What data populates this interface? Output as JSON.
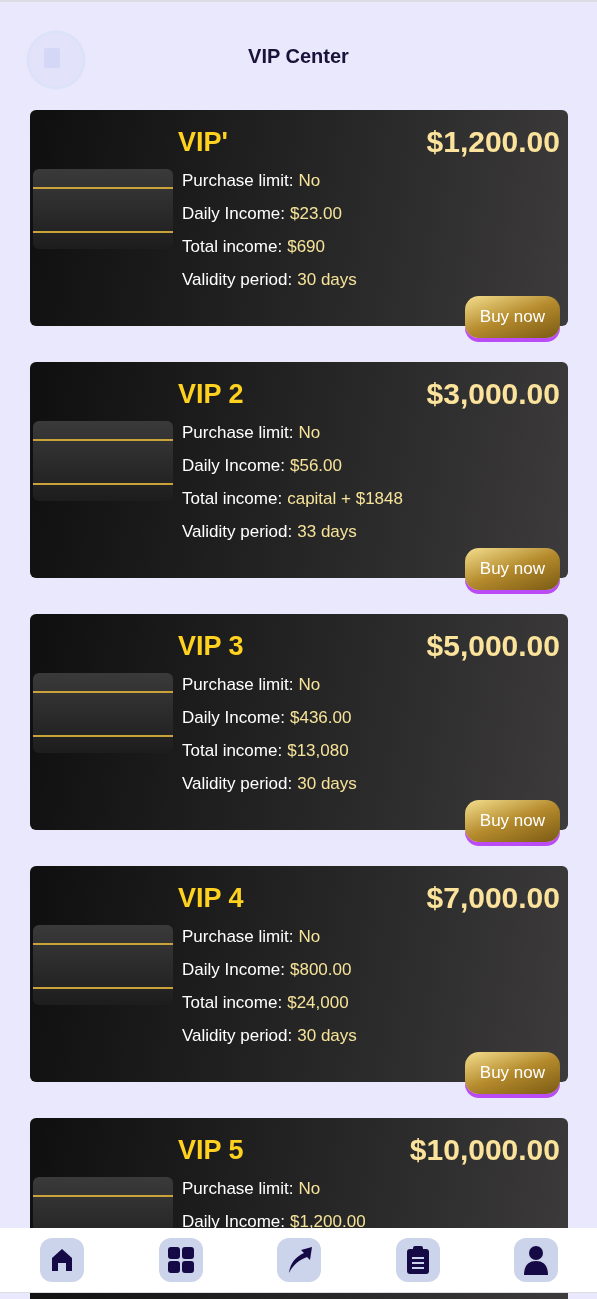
{
  "header": {
    "title": "VIP Center"
  },
  "plans": [
    {
      "name": "VIP'",
      "price": "$1,200.00",
      "rows": [
        {
          "label": "Purchase limit:",
          "value": "No"
        },
        {
          "label": "Daily Income:",
          "value": "$23.00"
        },
        {
          "label": "Total income:",
          "value": "$690"
        },
        {
          "label": "Validity period:",
          "value": "30 days"
        }
      ],
      "button": "Buy now"
    },
    {
      "name": "VIP 2",
      "price": "$3,000.00",
      "rows": [
        {
          "label": "Purchase limit:",
          "value": "No"
        },
        {
          "label": "Daily Income:",
          "value": "$56.00"
        },
        {
          "label": "Total income:",
          "value": "capital + $1848"
        },
        {
          "label": "Validity period:",
          "value": "33 days"
        }
      ],
      "button": "Buy now"
    },
    {
      "name": "VIP 3",
      "price": "$5,000.00",
      "rows": [
        {
          "label": "Purchase limit:",
          "value": "No"
        },
        {
          "label": "Daily Income:",
          "value": "$436.00"
        },
        {
          "label": "Total income:",
          "value": "$13,080"
        },
        {
          "label": "Validity period:",
          "value": "30 days"
        }
      ],
      "button": "Buy now"
    },
    {
      "name": "VIP 4",
      "price": "$7,000.00",
      "rows": [
        {
          "label": "Purchase limit:",
          "value": "No"
        },
        {
          "label": "Daily Income:",
          "value": "$800.00"
        },
        {
          "label": "Total income:",
          "value": "$24,000"
        },
        {
          "label": "Validity period:",
          "value": "30 days"
        }
      ],
      "button": "Buy now"
    },
    {
      "name": "VIP 5",
      "price": "$10,000.00",
      "rows": [
        {
          "label": "Purchase limit:",
          "value": "No"
        },
        {
          "label": "Daily Income:",
          "value": "$1,200.00"
        }
      ]
    }
  ],
  "nav": [
    {
      "kind": "home"
    },
    {
      "kind": "grid"
    },
    {
      "kind": "share"
    },
    {
      "kind": "clipboard"
    },
    {
      "kind": "user"
    }
  ]
}
